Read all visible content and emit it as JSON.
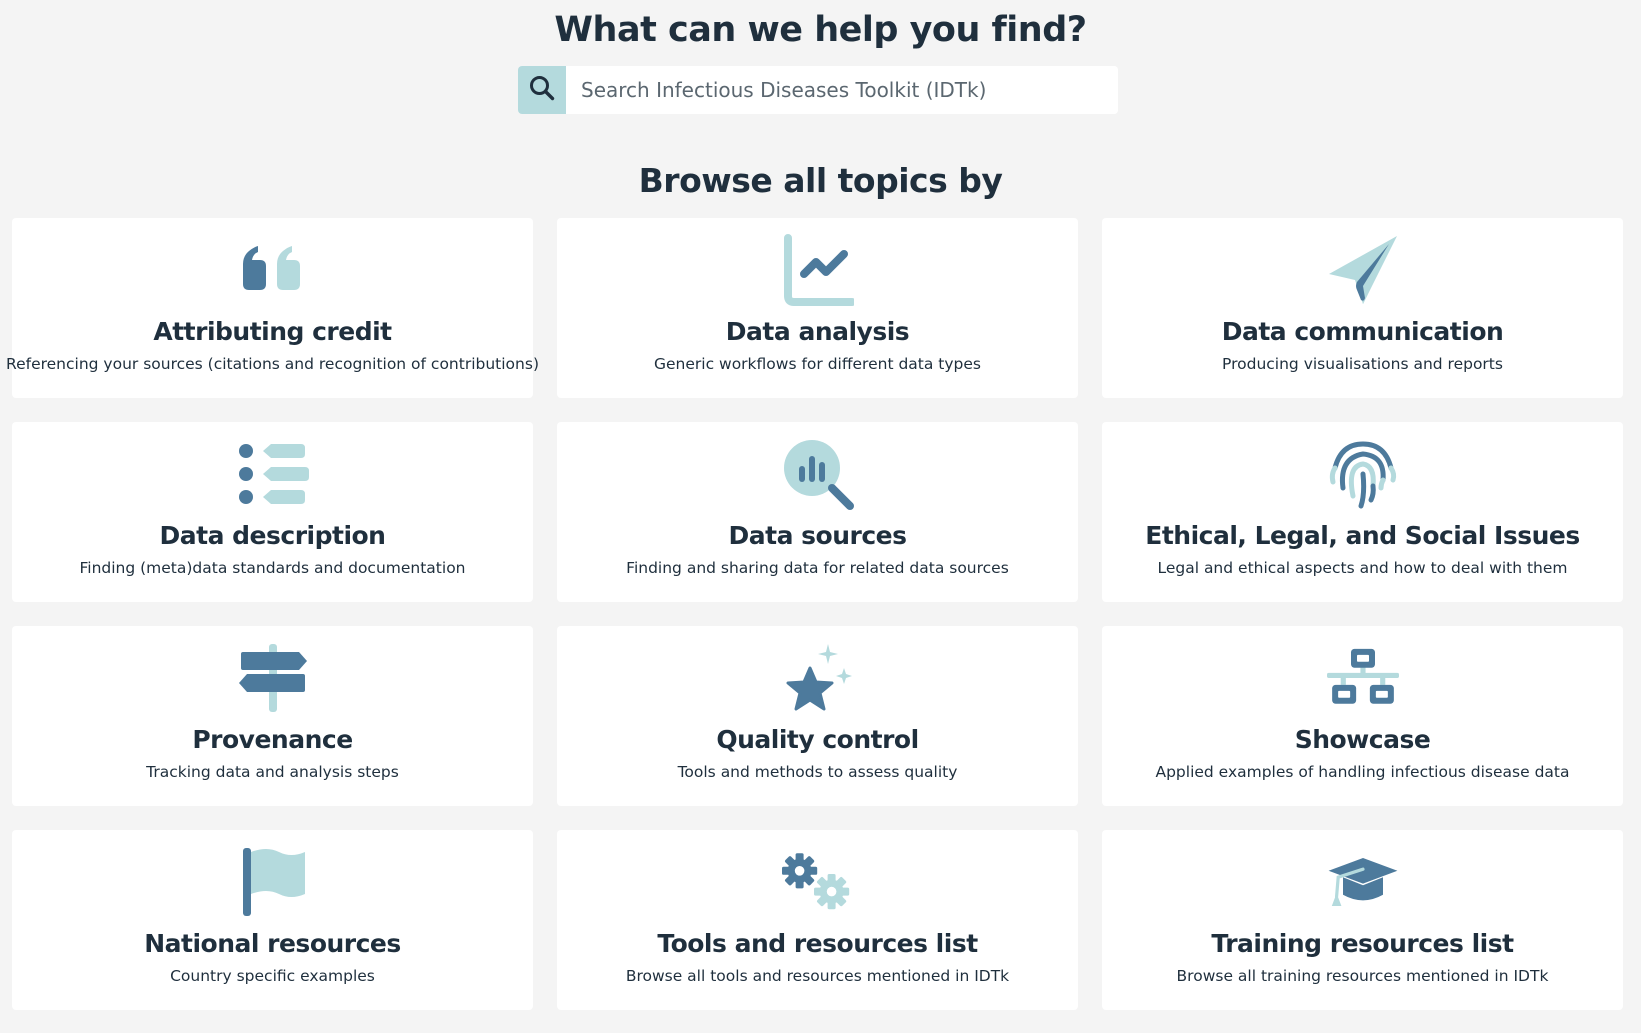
{
  "hero": {
    "title": "What can we help you find?"
  },
  "search": {
    "placeholder": "Search Infectious Diseases Toolkit (IDTk)",
    "icon": "search-icon"
  },
  "browse": {
    "title": "Browse all topics by"
  },
  "colors": {
    "dark_blue": "#4d7a9c",
    "light_blue": "#b4dadd",
    "text": "#1f2f3d",
    "background": "#f4f4f4"
  },
  "cards": [
    {
      "title": "Attributing credit",
      "description": "Referencing your sources (citations and recognition of contributions)",
      "icon": "quote-icon"
    },
    {
      "title": "Data analysis",
      "description": "Generic workflows for different data types",
      "icon": "line-chart-icon"
    },
    {
      "title": "Data communication",
      "description": "Producing visualisations and reports",
      "icon": "paper-plane-icon"
    },
    {
      "title": "Data description",
      "description": "Finding (meta)data standards and documentation",
      "icon": "list-icon"
    },
    {
      "title": "Data sources",
      "description": "Finding and sharing data for related data sources",
      "icon": "magnifier-chart-icon"
    },
    {
      "title": "Ethical, Legal, and Social Issues",
      "description": "Legal and ethical aspects and how to deal with them",
      "icon": "fingerprint-icon"
    },
    {
      "title": "Provenance",
      "description": "Tracking data and analysis steps",
      "icon": "signpost-icon"
    },
    {
      "title": "Quality control",
      "description": "Tools and methods to assess quality",
      "icon": "star-sparkle-icon"
    },
    {
      "title": "Showcase",
      "description": "Applied examples of handling infectious disease data",
      "icon": "sitemap-icon"
    },
    {
      "title": "National resources",
      "description": "Country specific examples",
      "icon": "flag-icon"
    },
    {
      "title": "Tools and resources list",
      "description": "Browse all tools and resources mentioned in IDTk",
      "icon": "gears-icon"
    },
    {
      "title": "Training resources list",
      "description": "Browse all training resources mentioned in IDTk",
      "icon": "graduation-cap-icon"
    }
  ]
}
